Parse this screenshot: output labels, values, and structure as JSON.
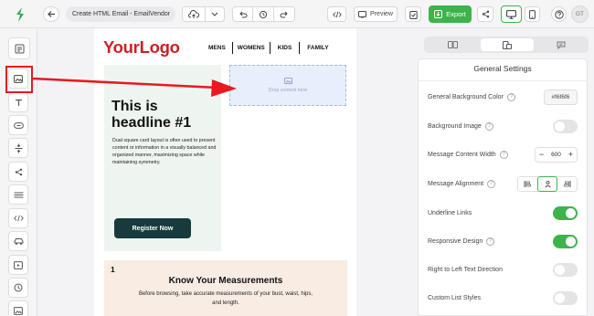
{
  "header": {
    "doc_title": "Create HTML Email - EmailVendor",
    "preview_label": "Preview",
    "export_label": "Export",
    "avatar_initials": "GT"
  },
  "email": {
    "logo": "YourLogo",
    "nav": [
      "MENS",
      "WOMENS",
      "KIDS",
      "FAMILY"
    ],
    "drop_text": "Drop content here",
    "headline": "This is headline #1",
    "body": "Dual square card layout is often used to present content or information in a visually balanced and organized manner, maximizing space while maintaining symmetry.",
    "cta": "Register Now",
    "section_number": "1",
    "section_title": "Know Your Measurements",
    "section_body": "Before browsing, take accurate measurements of your bust, waist, hips, and length."
  },
  "settings": {
    "title": "General Settings",
    "bg_color_label": "General Background Color",
    "bg_color_value": "#f6f6f6",
    "bg_image_label": "Background Image",
    "width_label": "Message Content Width",
    "width_value": "600",
    "align_label": "Message Alignment",
    "underline_label": "Underline Links",
    "responsive_label": "Responsive Design",
    "rtl_label": "Right to Left Text Direction",
    "list_label": "Custom List Styles",
    "toggles": {
      "bg_image": false,
      "underline": true,
      "responsive": true,
      "rtl": false,
      "list": false
    }
  },
  "colors": {
    "accent_green": "#3cb44b",
    "logo_red": "#cc1f25",
    "annotation_red": "#e8191f",
    "card_green_bg": "#eef5f0",
    "cta_bg": "#173b3d",
    "section_bg": "#f8ece3",
    "drop_zone": "#e8eefb"
  }
}
